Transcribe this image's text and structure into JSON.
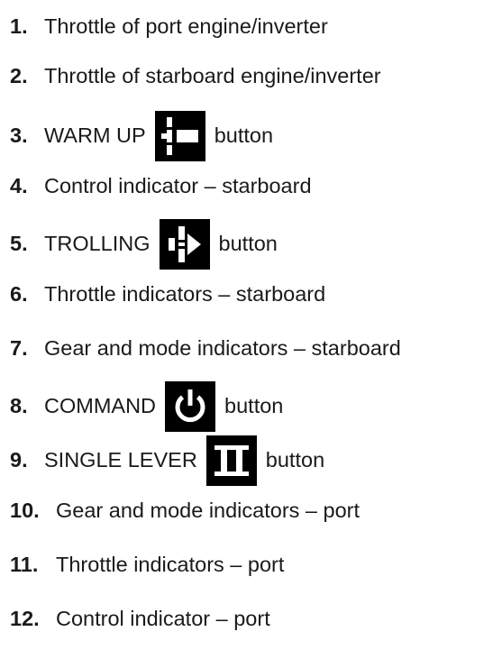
{
  "items": [
    {
      "number": "1.",
      "text": "Throttle of port engine/inverter"
    },
    {
      "number": "2.",
      "text": "Throttle of starboard engine/inverter"
    },
    {
      "number": "3.",
      "text": "WARM UP",
      "suffix": "button",
      "icon": "warm-up-icon"
    },
    {
      "number": "4.",
      "text": "Control indicator – starboard"
    },
    {
      "number": "5.",
      "text": "TROLLING",
      "suffix": "button",
      "icon": "trolling-icon"
    },
    {
      "number": "6.",
      "text": "Throttle indicators – starboard"
    },
    {
      "number": "7.",
      "text": "Gear and mode indicators – starboard"
    },
    {
      "number": "8.",
      "text": "COMMAND",
      "suffix": "button",
      "icon": "power-icon"
    },
    {
      "number": "9.",
      "text": "SINGLE LEVER",
      "suffix": "button",
      "icon": "single-lever-icon"
    },
    {
      "number": "10.",
      "text": "Gear and mode indicators – port"
    },
    {
      "number": "11.",
      "text": "Throttle indicators – port"
    },
    {
      "number": "12.",
      "text": "Control indicator – port"
    }
  ],
  "colors": {
    "text": "#1a1a1a",
    "icon_background": "#000000",
    "icon_foreground": "#ffffff"
  }
}
